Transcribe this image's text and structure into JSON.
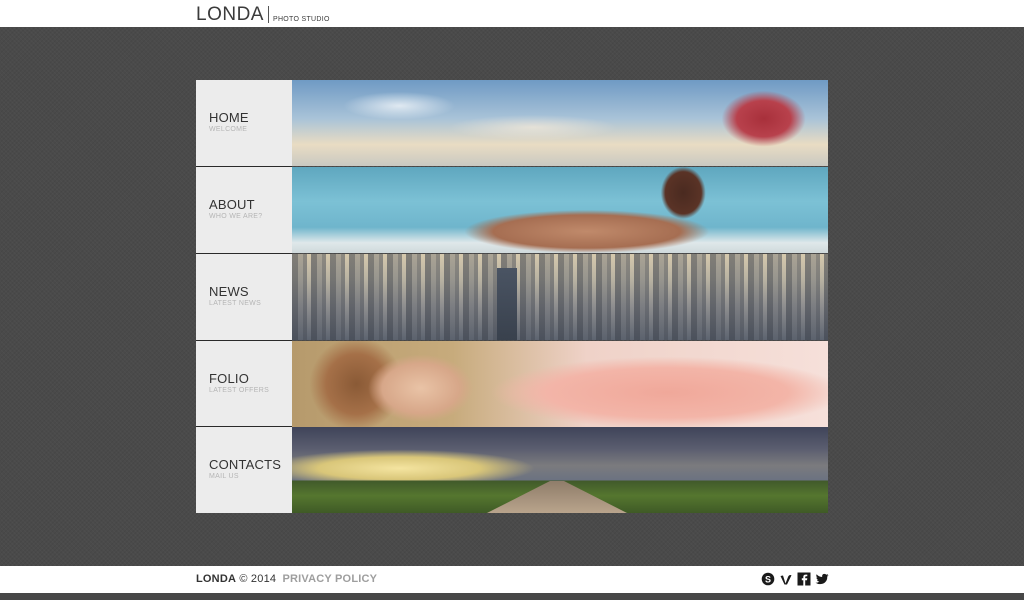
{
  "header": {
    "logo": "LONDA",
    "tagline": "PHOTO STUDIO"
  },
  "menu": {
    "items": [
      {
        "title": "HOME",
        "subtitle": "WELCOME"
      },
      {
        "title": "ABOUT",
        "subtitle": "WHO WE ARE?"
      },
      {
        "title": "NEWS",
        "subtitle": "LATEST NEWS"
      },
      {
        "title": "FOLIO",
        "subtitle": "LATEST OFFERS"
      },
      {
        "title": "CONTACTS",
        "subtitle": "MAIL US"
      }
    ]
  },
  "footer": {
    "brand": "LONDA",
    "copyright": "© 2014",
    "privacy": "PRIVACY POLICY",
    "social": [
      "skype-icon",
      "vimeo-icon",
      "facebook-icon",
      "twitter-icon"
    ]
  },
  "colors": {
    "background": "#4a4a4a",
    "label_box": "#ececec",
    "text_dark": "#333333",
    "text_muted": "#b5b5b5",
    "privacy_link": "#9e9e9e"
  }
}
